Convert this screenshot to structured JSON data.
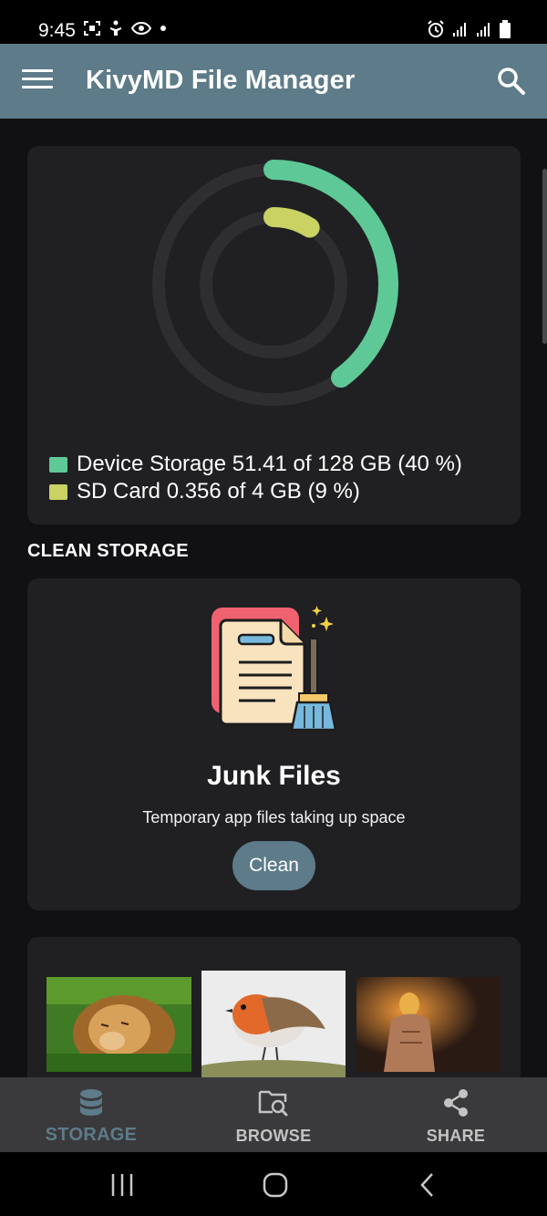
{
  "status_bar": {
    "time": "9:45",
    "left_icons": [
      "screenshot-icon",
      "accessibility-icon",
      "eye-icon",
      "dot-icon"
    ],
    "right_icons": [
      "alarm-icon",
      "signal-icon",
      "signal-icon",
      "battery-icon"
    ]
  },
  "app_bar": {
    "title": "KivyMD File Manager",
    "menu_icon": "menu-icon",
    "search_icon": "search-icon",
    "color": "#5d7b89"
  },
  "storage": {
    "device": {
      "label": "Device Storage 51.41 of 128 GB (40 %)",
      "used": 51.41,
      "total": 128,
      "percent": 40,
      "color": "#5ec996"
    },
    "sd": {
      "label": "SD Card 0.356 of 4 GB (9 %)",
      "used": 0.356,
      "total": 4,
      "percent": 9,
      "color": "#c9d263"
    },
    "track_color": "#2e2e31"
  },
  "clean_storage": {
    "section_title": "CLEAN STORAGE",
    "junk_title": "Junk Files",
    "junk_subtitle": "Temporary app files taking up space",
    "clean_button": "Clean"
  },
  "images": [
    "lion-photo",
    "robin-bird-photo",
    "man-with-lightbulb-photo"
  ],
  "bottom_nav": {
    "items": [
      {
        "label": "STORAGE",
        "icon": "database-icon",
        "active": true
      },
      {
        "label": "BROWSE",
        "icon": "folder-search-icon",
        "active": false
      },
      {
        "label": "SHARE",
        "icon": "share-icon",
        "active": false
      }
    ]
  },
  "system_nav": [
    "recents-icon",
    "home-icon",
    "back-icon"
  ]
}
